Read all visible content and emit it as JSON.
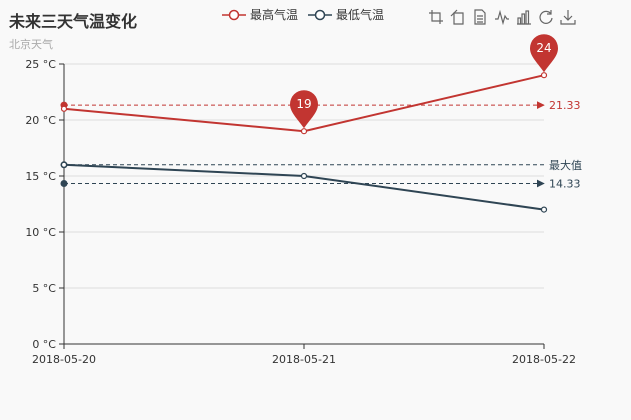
{
  "title": "未来三天气温变化",
  "subtitle": "北京天气",
  "legend": [
    {
      "name": "最高气温",
      "color": "#c23531"
    },
    {
      "name": "最低气温",
      "color": "#2f4554"
    }
  ],
  "toolbox": [
    "zoom-icon",
    "zoom-reset-icon",
    "data-view-icon",
    "line-chart-icon",
    "bar-chart-icon",
    "restore-icon",
    "save-image-icon"
  ],
  "chart_data": {
    "type": "line",
    "categories": [
      "2018-05-20",
      "2018-05-21",
      "2018-05-22"
    ],
    "ylim": [
      0,
      25
    ],
    "y_ticks": [
      0,
      5,
      10,
      15,
      20,
      25
    ],
    "y_unit": "°C",
    "grid": "horizontal",
    "series": [
      {
        "name": "最高气温",
        "color": "#c23531",
        "values": [
          21,
          19,
          24
        ],
        "mark_points": [
          {
            "label": "19",
            "category_index": 1,
            "value": 19
          },
          {
            "label": "24",
            "category_index": 2,
            "value": 24
          }
        ],
        "mark_line": {
          "value": 21.33,
          "label": "21.33"
        }
      },
      {
        "name": "最低气温",
        "color": "#2f4554",
        "values": [
          16,
          15,
          12
        ],
        "mark_lines": [
          {
            "value": 16,
            "label": "最大值",
            "arrow": false
          },
          {
            "value": 14.33,
            "label": "14.33",
            "arrow": true
          }
        ]
      }
    ]
  }
}
